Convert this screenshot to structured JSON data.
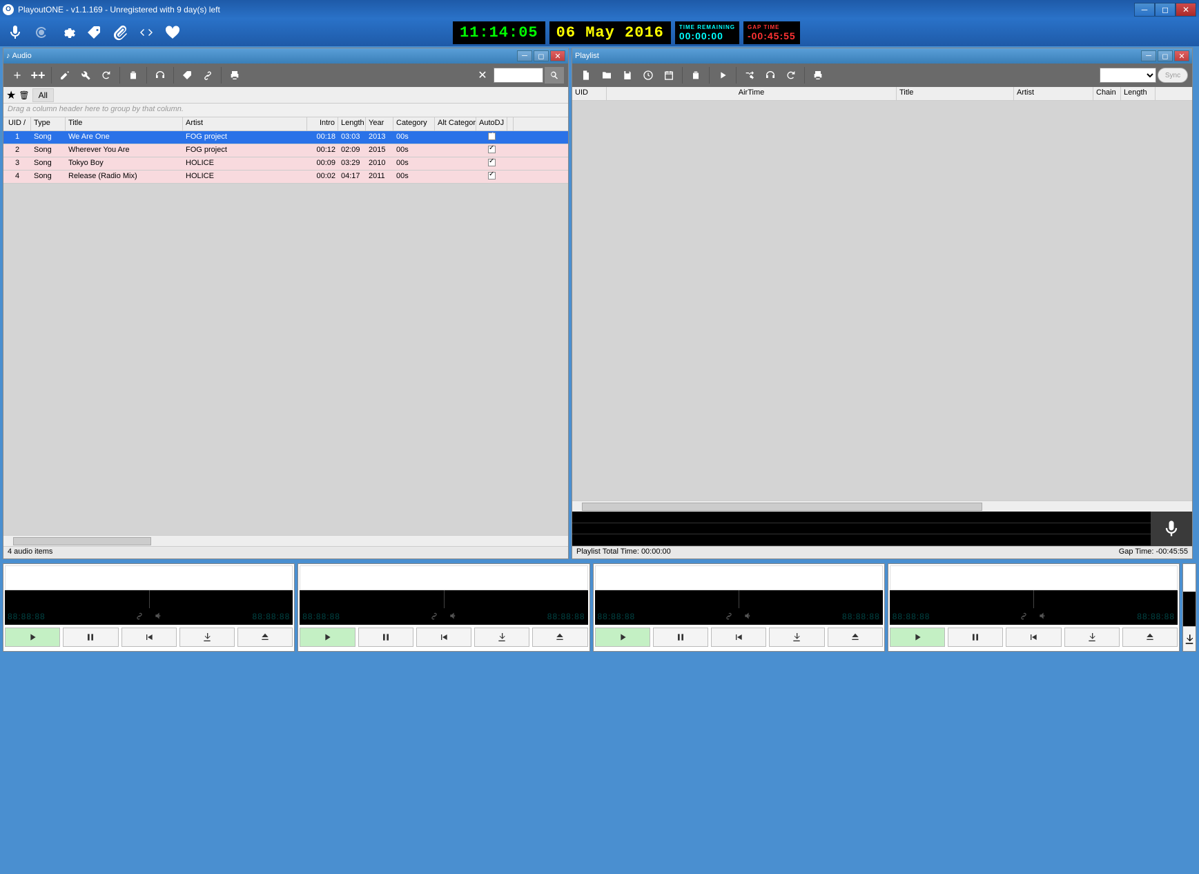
{
  "app": {
    "title": "PlayoutONE - v1.1.169 - Unregistered with 9 day(s) left",
    "icon_letter": "O"
  },
  "clocks": {
    "time": "11:14:05",
    "date": "06 May 2016",
    "remaining_label": "TIME REMAINING",
    "remaining_value": "00:00:00",
    "gap_label": "GAP TIME",
    "gap_value": "-00:45:55"
  },
  "audio_panel": {
    "title": "Audio",
    "filter_all": "All",
    "group_hint": "Drag a column header here to group by that column.",
    "columns": [
      "UID /",
      "Type",
      "Title",
      "Artist",
      "Intro",
      "Length",
      "Year",
      "Category",
      "Alt Category",
      "AutoDJ"
    ],
    "rows": [
      {
        "uid": "1",
        "type": "Song",
        "title": "We Are One",
        "artist": "FOG project",
        "intro": "00:18",
        "length": "03:03",
        "year": "2013",
        "category": "00s",
        "altcat": "",
        "autodj": true,
        "selected": true
      },
      {
        "uid": "2",
        "type": "Song",
        "title": "Wherever You Are",
        "artist": "FOG project",
        "intro": "00:12",
        "length": "02:09",
        "year": "2015",
        "category": "00s",
        "altcat": "",
        "autodj": true,
        "pink": true
      },
      {
        "uid": "3",
        "type": "Song",
        "title": "Tokyo Boy",
        "artist": "HOLICE",
        "intro": "00:09",
        "length": "03:29",
        "year": "2010",
        "category": "00s",
        "altcat": "",
        "autodj": true,
        "pink": true
      },
      {
        "uid": "4",
        "type": "Song",
        "title": "Release (Radio Mix)",
        "artist": "HOLICE",
        "intro": "00:02",
        "length": "04:17",
        "year": "2011",
        "category": "00s",
        "altcat": "",
        "autodj": true,
        "pink": true
      }
    ],
    "status": "4 audio items"
  },
  "playlist_panel": {
    "title": "Playlist",
    "columns": [
      "UID",
      "AirTime",
      "Title",
      "Artist",
      "Chain",
      "Length"
    ],
    "status_left": "Playlist Total Time: 00:00:00",
    "status_right": "Gap Time: -00:45:55",
    "sync_label": "Sync"
  },
  "player": {
    "digits": "88:88:88"
  }
}
